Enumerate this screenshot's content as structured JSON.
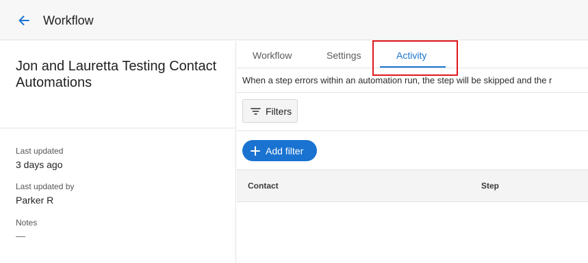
{
  "header": {
    "title": "Workflow",
    "back_icon": "arrow-left-icon",
    "accent_color": "#1a73d1"
  },
  "workflow": {
    "name": "Jon and Lauretta Testing Contact Automations",
    "meta": {
      "last_updated_label": "Last updated",
      "last_updated_value": "3 days ago",
      "last_updated_by_label": "Last updated by",
      "last_updated_by_value": "Parker R",
      "notes_label": "Notes",
      "notes_value": "—"
    }
  },
  "tabs": [
    {
      "label": "Workflow",
      "active": false
    },
    {
      "label": "Settings",
      "active": false
    },
    {
      "label": "Activity",
      "active": true
    }
  ],
  "activity": {
    "notice": "When a step errors within an automation run, the step will be skipped and the r",
    "filters_label": "Filters",
    "filters_icon": "filter-lines-icon",
    "add_filter_label": "Add filter",
    "add_filter_icon": "plus-icon",
    "table": {
      "columns": [
        "Contact",
        "Step"
      ]
    }
  },
  "highlight_color": "#e0151a"
}
